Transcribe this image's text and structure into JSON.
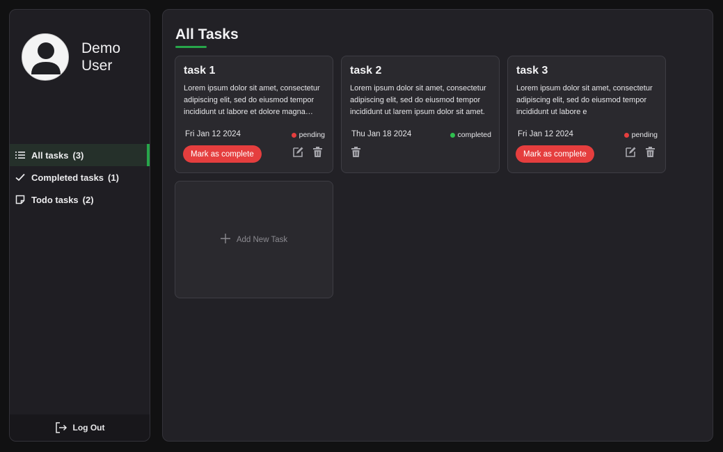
{
  "user": {
    "name": "Demo User"
  },
  "sidebar": {
    "items": [
      {
        "label": "All tasks",
        "count": "(3)",
        "icon": "list-icon",
        "active": true
      },
      {
        "label": "Completed tasks",
        "count": "(1)",
        "icon": "check-icon",
        "active": false
      },
      {
        "label": "Todo tasks",
        "count": "(2)",
        "icon": "note-icon",
        "active": false
      }
    ],
    "logout_label": "Log Out"
  },
  "main": {
    "title": "All Tasks",
    "add_label": "Add New Task",
    "tasks": [
      {
        "title": "task 1",
        "description": "Lorem ipsum dolor sit amet, consectetur adipiscing elit, sed do eiusmod tempor incididunt ut labore et dolore magna aliqua.",
        "date": "Fri Jan 12 2024",
        "status": "pending",
        "button": "Mark as complete"
      },
      {
        "title": "task 2",
        "description": "Lorem ipsum dolor sit amet, consectetur adipiscing elit, sed do eiusmod tempor incididunt ut larem ipsum dolor sit amet.",
        "date": "Thu Jan 18 2024",
        "status": "completed",
        "button": ""
      },
      {
        "title": "task 3",
        "description": "Lorem ipsum dolor sit amet, consectetur adipiscing elit, sed do eiusmod tempor incididunt ut labore e",
        "date": "Fri Jan 12 2024",
        "status": "pending",
        "button": "Mark as complete"
      }
    ]
  },
  "colors": {
    "accent": "#27a64a",
    "pending": "#e53e3e",
    "completed": "#2fbf4f",
    "button": "#e53e3e"
  }
}
